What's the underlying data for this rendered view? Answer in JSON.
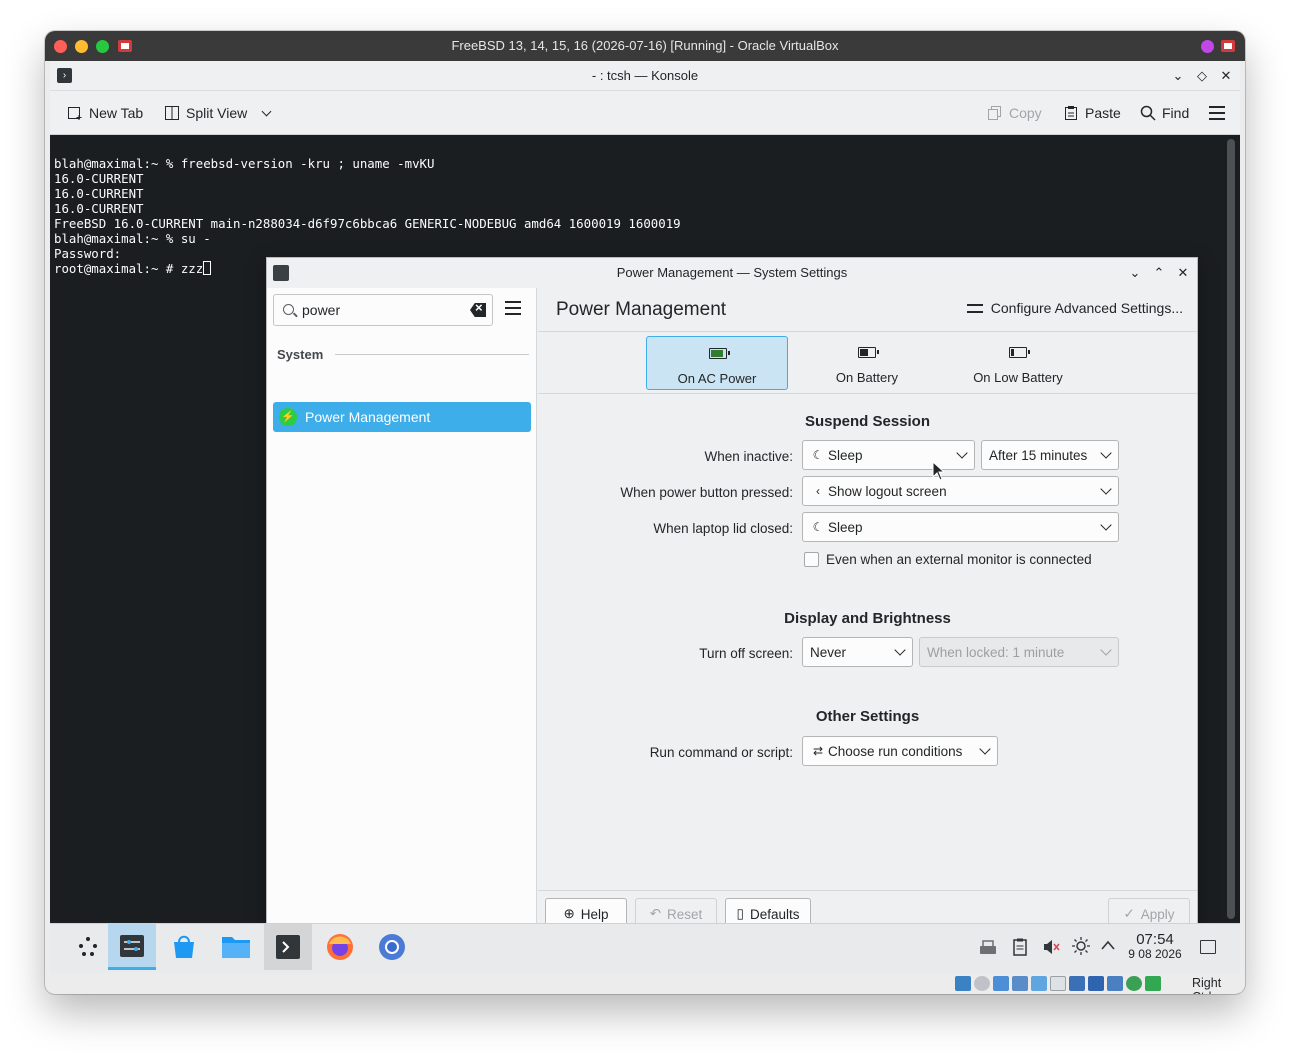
{
  "vbox": {
    "title": "FreeBSD 13, 14, 15, 16 (2026-07-16) [Running] - Oracle VirtualBox",
    "host_key": "Right Ctrl"
  },
  "konsole": {
    "title": "- : tcsh — Konsole",
    "toolbar": {
      "new_tab": "New Tab",
      "split_view": "Split View",
      "copy": "Copy",
      "paste": "Paste",
      "find": "Find"
    },
    "lines": [
      "blah@maximal:~ % freebsd-version -kru ; uname -mvKU",
      "16.0-CURRENT",
      "16.0-CURRENT",
      "16.0-CURRENT",
      "FreeBSD 16.0-CURRENT main-n288034-d6f97c6bbca6 GENERIC-NODEBUG amd64 1600019 1600019",
      "blah@maximal:~ % su -",
      "Password:",
      "root@maximal:~ # zzz"
    ]
  },
  "settings": {
    "window_title": "Power Management — System Settings",
    "search": {
      "value": "power"
    },
    "sidebar": {
      "section": "System",
      "item": "Power Management"
    },
    "page_title": "Power Management",
    "advanced_button": "Configure Advanced Settings...",
    "tabs": [
      {
        "label": "On AC Power",
        "active": true
      },
      {
        "label": "On Battery",
        "active": false
      },
      {
        "label": "On Low Battery",
        "active": false
      }
    ],
    "suspend": {
      "heading": "Suspend Session",
      "when_inactive_label": "When inactive:",
      "when_inactive_value": "Sleep",
      "when_inactive_delay": "After 15 minutes",
      "power_button_label": "When power button pressed:",
      "power_button_value": "Show logout screen",
      "lid_label": "When laptop lid closed:",
      "lid_value": "Sleep",
      "external_monitor_label": "Even when an external monitor is connected",
      "external_monitor_checked": false
    },
    "display": {
      "heading": "Display and Brightness",
      "turn_off_label": "Turn off screen:",
      "turn_off_value": "Never",
      "when_locked_value": "When locked: 1 minute"
    },
    "other": {
      "heading": "Other Settings",
      "run_command_label": "Run command or script:",
      "run_command_value": "Choose run conditions"
    },
    "footer": {
      "help": "Help",
      "reset": "Reset",
      "defaults": "Defaults",
      "apply": "Apply"
    }
  },
  "taskbar": {
    "time": "07:54",
    "date": "9 08 2026"
  }
}
